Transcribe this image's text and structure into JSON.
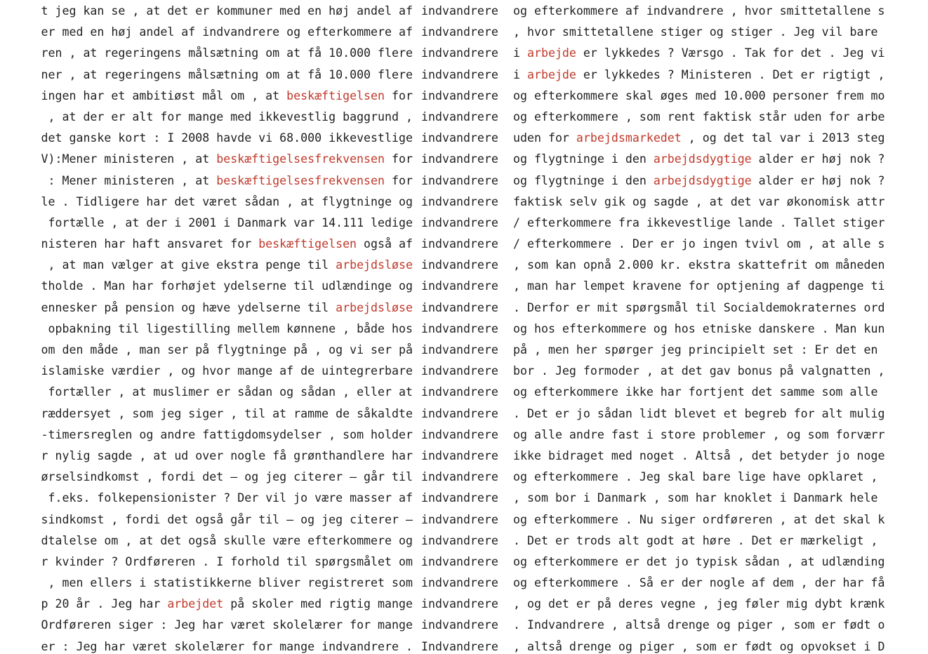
{
  "colors": {
    "text": "#1f1f1f",
    "highlight": "#c0392b",
    "background": "#ffffff"
  },
  "concordance": {
    "lines": [
      {
        "left": [
          {
            "t": "t jeg kan se , at det er kommuner med en høj andel af"
          }
        ],
        "keyword": "indvandrere",
        "right": [
          {
            "t": "og efterkommere af indvandrere , hvor smittetallene s"
          }
        ]
      },
      {
        "left": [
          {
            "t": "er med en høj andel af indvandrere og efterkommere af"
          }
        ],
        "keyword": "indvandrere",
        "right": [
          {
            "t": ", hvor smittetallene stiger og stiger . Jeg vil bare"
          }
        ]
      },
      {
        "left": [
          {
            "t": "ren , at regeringens målsætning om at få 10.000 flere"
          }
        ],
        "keyword": "indvandrere",
        "right": [
          {
            "t": "i "
          },
          {
            "t": "arbejde",
            "hl": true
          },
          {
            "t": " er lykkedes ? Værsgo . Tak for det . Jeg vi"
          }
        ]
      },
      {
        "left": [
          {
            "t": "ner , at regeringens målsætning om at få 10.000 flere"
          }
        ],
        "keyword": "indvandrere",
        "right": [
          {
            "t": "i "
          },
          {
            "t": "arbejde",
            "hl": true
          },
          {
            "t": " er lykkedes ? Ministeren . Det er rigtigt ,"
          }
        ]
      },
      {
        "left": [
          {
            "t": "ingen har et ambitiøst mål om , at "
          },
          {
            "t": "beskæftigelsen",
            "hl": true
          },
          {
            "t": " for"
          }
        ],
        "keyword": "indvandrere",
        "right": [
          {
            "t": "og efterkommere skal øges med 10.000 personer frem mo"
          }
        ]
      },
      {
        "left": [
          {
            "t": " , at der er alt for mange med ikkevestlig baggrund ,"
          }
        ],
        "keyword": "indvandrere",
        "right": [
          {
            "t": "og efterkommere , som rent faktisk står uden for arbe"
          }
        ]
      },
      {
        "left": [
          {
            "t": "det ganske kort : I 2008 havde vi 68.000 ikkevestlige"
          }
        ],
        "keyword": "indvandrere",
        "right": [
          {
            "t": "uden for "
          },
          {
            "t": "arbejdsmarkedet",
            "hl": true
          },
          {
            "t": " , og det tal var i 2013 steg"
          }
        ]
      },
      {
        "left": [
          {
            "t": "V):Mener ministeren , at "
          },
          {
            "t": "beskæftigelsesfrekvensen",
            "hl": true
          },
          {
            "t": " for"
          }
        ],
        "keyword": "indvandrere",
        "right": [
          {
            "t": "og flygtninge i den "
          },
          {
            "t": "arbejdsdygtige",
            "hl": true
          },
          {
            "t": " alder er høj nok ?"
          }
        ]
      },
      {
        "left": [
          {
            "t": " : Mener ministeren , at "
          },
          {
            "t": "beskæftigelsesfrekvensen",
            "hl": true
          },
          {
            "t": " for"
          }
        ],
        "keyword": "indvandrere",
        "right": [
          {
            "t": "og flygtninge i den "
          },
          {
            "t": "arbejdsdygtige",
            "hl": true
          },
          {
            "t": " alder er høj nok ?"
          }
        ]
      },
      {
        "left": [
          {
            "t": "le . Tidligere har det været sådan , at flygtninge og"
          }
        ],
        "keyword": "indvandrere",
        "right": [
          {
            "t": "faktisk selv gik og sagde , at det var økonomisk attr"
          }
        ]
      },
      {
        "left": [
          {
            "t": " fortælle , at der i 2001 i Danmark var 14.111 ledige"
          }
        ],
        "keyword": "indvandrere",
        "right": [
          {
            "t": "/ efterkommere fra ikkevestlige lande . Tallet stiger"
          }
        ]
      },
      {
        "left": [
          {
            "t": "nisteren har haft ansvaret for "
          },
          {
            "t": "beskæftigelsen",
            "hl": true
          },
          {
            "t": " også af"
          }
        ],
        "keyword": "indvandrere",
        "right": [
          {
            "t": "/ efterkommere . Der er jo ingen tvivl om , at alle s"
          }
        ]
      },
      {
        "left": [
          {
            "t": " , at man vælger at give ekstra penge til "
          },
          {
            "t": "arbejdsløse",
            "hl": true
          }
        ],
        "keyword": "indvandrere",
        "right": [
          {
            "t": ", som kan opnå 2.000 kr. ekstra skattefrit om måneden"
          }
        ]
      },
      {
        "left": [
          {
            "t": "tholde . Man har forhøjet ydelserne til udlændinge og"
          }
        ],
        "keyword": "indvandrere",
        "right": [
          {
            "t": ", man har lempet kravene for optjening af dagpenge ti"
          }
        ]
      },
      {
        "left": [
          {
            "t": "ennesker på pension og hæve ydelserne til "
          },
          {
            "t": "arbejdsløse",
            "hl": true
          }
        ],
        "keyword": "indvandrere",
        "right": [
          {
            "t": ". Derfor er mit spørgsmål til Socialdemokraternes ord"
          }
        ]
      },
      {
        "left": [
          {
            "t": " opbakning til ligestilling mellem kønnene , både hos"
          }
        ],
        "keyword": "indvandrere",
        "right": [
          {
            "t": "og hos efterkommere og hos etniske danskere . Man kun"
          }
        ]
      },
      {
        "left": [
          {
            "t": "om den måde , man ser på flygtninge på , og vi ser på"
          }
        ],
        "keyword": "indvandrere",
        "right": [
          {
            "t": "på , men her spørger jeg principielt set : Er det en"
          }
        ]
      },
      {
        "left": [
          {
            "t": "islamiske værdier , og hvor mange af de uintegrerbare"
          }
        ],
        "keyword": "indvandrere",
        "right": [
          {
            "t": "bor . Jeg formoder , at det gav bonus på valgnatten ,"
          }
        ]
      },
      {
        "left": [
          {
            "t": " fortæller , at muslimer er sådan og sådan , eller at"
          }
        ],
        "keyword": "indvandrere",
        "right": [
          {
            "t": "og efterkommere ikke har fortjent det samme som alle"
          }
        ]
      },
      {
        "left": [
          {
            "t": "ræddersyet , som jeg siger , til at ramme de såkaldte"
          }
        ],
        "keyword": "indvandrere",
        "right": [
          {
            "t": ". Det er jo sådan lidt blevet et begreb for alt mulig"
          }
        ]
      },
      {
        "left": [
          {
            "t": "-timersreglen og andre fattigdomsydelser , som holder"
          }
        ],
        "keyword": "indvandrere",
        "right": [
          {
            "t": "og alle andre fast i store problemer , og som forværr"
          }
        ]
      },
      {
        "left": [
          {
            "t": "r nylig sagde , at ud over nogle få grønthandlere har"
          }
        ],
        "keyword": "indvandrere",
        "right": [
          {
            "t": "ikke bidraget med noget . Altså , det betyder jo noge"
          }
        ]
      },
      {
        "left": [
          {
            "t": "ørselsindkomst , fordi det – og jeg citerer – går til"
          }
        ],
        "keyword": "indvandrere",
        "right": [
          {
            "t": "og efterkommere . Jeg skal bare lige have opklaret ,"
          }
        ]
      },
      {
        "left": [
          {
            "t": " f.eks. folkepensionister ? Der vil jo være masser af"
          }
        ],
        "keyword": "indvandrere",
        "right": [
          {
            "t": ", som bor i Danmark , som har knoklet i Danmark hele"
          }
        ]
      },
      {
        "left": [
          {
            "t": "sindkomst , fordi det også går til – og jeg citerer –"
          }
        ],
        "keyword": "indvandrere",
        "right": [
          {
            "t": "og efterkommere . Nu siger ordføreren , at det skal k"
          }
        ]
      },
      {
        "left": [
          {
            "t": "dtalelse om , at det også skulle være efterkommere og"
          }
        ],
        "keyword": "indvandrere",
        "right": [
          {
            "t": ". Det er trods alt godt at høre . Det er mærkeligt ,"
          }
        ]
      },
      {
        "left": [
          {
            "t": "r kvinder ? Ordføreren . I forhold til spørgsmålet om"
          }
        ],
        "keyword": "indvandrere",
        "right": [
          {
            "t": "og efterkommere er det jo typisk sådan , at udlænding"
          }
        ]
      },
      {
        "left": [
          {
            "t": " , men ellers i statistikkerne bliver registreret som"
          }
        ],
        "keyword": "indvandrere",
        "right": [
          {
            "t": "og efterkommere . Så er der nogle af dem , der har få"
          }
        ]
      },
      {
        "left": [
          {
            "t": "p 20 år . Jeg har "
          },
          {
            "t": "arbejdet",
            "hl": true
          },
          {
            "t": " på skoler med rigtig mange"
          }
        ],
        "keyword": "indvandrere",
        "right": [
          {
            "t": ", og det er på deres vegne , jeg føler mig dybt krænk"
          }
        ]
      },
      {
        "left": [
          {
            "t": "Ordføreren siger : Jeg har været skolelærer for mange"
          }
        ],
        "keyword": "indvandrere",
        "right": [
          {
            "t": ". Indvandrere , altså drenge og piger , som er født o"
          }
        ]
      },
      {
        "left": [
          {
            "t": "er : Jeg har været skolelærer for mange indvandrere ."
          }
        ],
        "keyword": "Indvandrere",
        "right": [
          {
            "t": ", altså drenge og piger , som er født og opvokset i D"
          }
        ]
      }
    ]
  }
}
